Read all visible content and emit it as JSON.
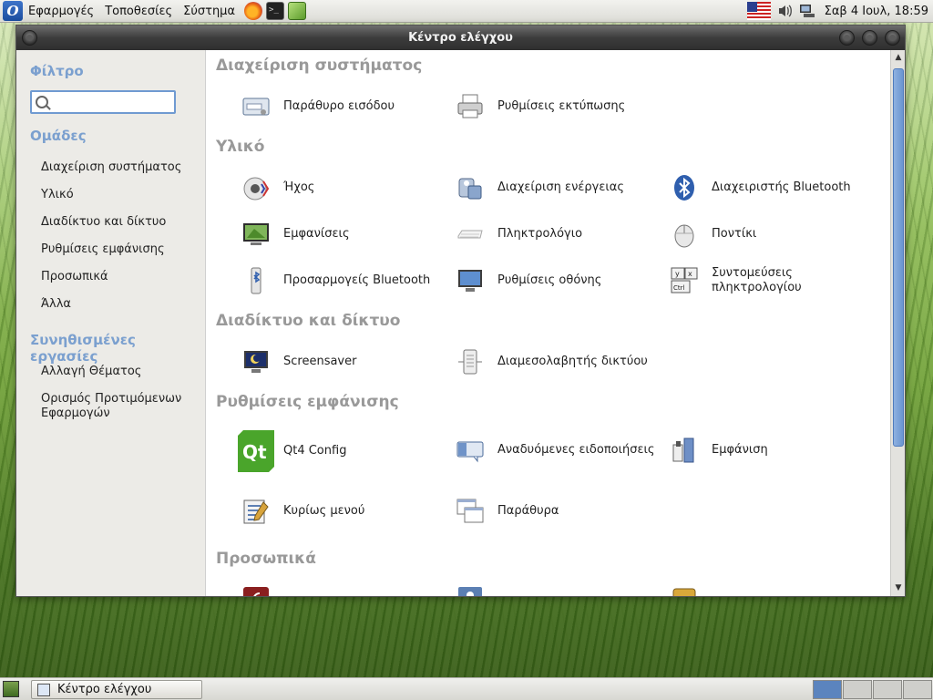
{
  "top_panel": {
    "menus": [
      "Εφαρμογές",
      "Τοποθεσίες",
      "Σύστημα"
    ],
    "clock": "Σαβ  4 Ιουλ, 18:59"
  },
  "window": {
    "title": "Κέντρο ελέγχου"
  },
  "sidebar": {
    "filter_heading": "Φίλτρο",
    "filter_value": "",
    "groups_heading": "Ομάδες",
    "groups": [
      "Διαχείριση συστήματος",
      "Υλικό",
      "Διαδίκτυο και δίκτυο",
      "Ρυθμίσεις εμφάνισης",
      "Προσωπικά",
      "Άλλα"
    ],
    "tasks_heading": "Συνηθισμένες εργασίες",
    "tasks": [
      "Αλλαγή Θέματος",
      "Ορισμός Προτιμόμενων Εφαρμογών"
    ]
  },
  "sections": [
    {
      "title": "Διαχείριση συστήματος",
      "items": [
        {
          "label": "Παράθυρο εισόδου",
          "icon": "login-window-icon"
        },
        {
          "label": "Ρυθμίσεις εκτύπωσης",
          "icon": "printer-icon"
        }
      ]
    },
    {
      "title": "Υλικό",
      "items": [
        {
          "label": "Ήχος",
          "icon": "sound-icon"
        },
        {
          "label": "Διαχείριση ενέργειας",
          "icon": "power-management-icon"
        },
        {
          "label": "Διαχειριστής Bluetooth",
          "icon": "bluetooth-icon"
        },
        {
          "label": "Εμφανίσεις",
          "icon": "displays-icon"
        },
        {
          "label": "Πληκτρολόγιο",
          "icon": "keyboard-icon"
        },
        {
          "label": "Ποντίκι",
          "icon": "mouse-icon"
        },
        {
          "label": "Προσαρμογείς Bluetooth",
          "icon": "bluetooth-adapter-icon"
        },
        {
          "label": "Ρυθμίσεις οθόνης",
          "icon": "monitor-icon"
        },
        {
          "label": "Συντομεύσεις πληκτρολογίου",
          "icon": "keyboard-shortcuts-icon"
        }
      ]
    },
    {
      "title": "Διαδίκτυο και δίκτυο",
      "items": [
        {
          "label": "Screensaver",
          "icon": "screensaver-icon"
        },
        {
          "label": "Διαμεσολαβητής δικτύου",
          "icon": "network-proxy-icon"
        }
      ]
    },
    {
      "title": "Ρυθμίσεις εμφάνισης",
      "items": [
        {
          "label": "Qt4 Config",
          "icon": "qt-icon"
        },
        {
          "label": "Αναδυόμενες ειδοποιήσεις",
          "icon": "notifications-icon"
        },
        {
          "label": "Εμφάνιση",
          "icon": "appearance-icon"
        },
        {
          "label": "Κυρίως μενού",
          "icon": "main-menu-icon"
        },
        {
          "label": "Παράθυρα",
          "icon": "windows-icon"
        }
      ]
    },
    {
      "title": "Προσωπικά",
      "items": []
    }
  ],
  "taskbar": {
    "task_label": "Κέντρο ελέγχου"
  },
  "colors": {
    "heading_blue": "#7ba0cf",
    "section_grey": "#999999",
    "scroll_thumb": "#6b95d1"
  }
}
